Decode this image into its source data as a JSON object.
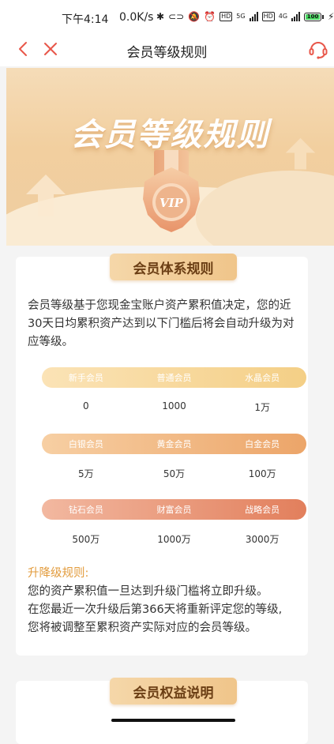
{
  "status_bar": {
    "time": "下午4:14",
    "speed": "0.0K/s",
    "battery": "100",
    "network_1": "5G",
    "network_2": "4G",
    "hd_1": "HD",
    "hd_2": "HD"
  },
  "nav": {
    "title": "会员等级规则",
    "back_icon": "chevron-left-icon",
    "close_icon": "close-icon",
    "service_icon": "headset-icon",
    "accent_color": "#e8574a"
  },
  "banner": {
    "title": "会员等级规则",
    "medal_label": "VIP"
  },
  "section1": {
    "tag": "会员体系规则",
    "intro": "会员等级基于您现金宝账户资产累积值决定，您的近30天日均累积资产达到以下门槛后将会自动升级为对应等级。",
    "levels": [
      {
        "name": "新手会员",
        "threshold": "0"
      },
      {
        "name": "普通会员",
        "threshold": "1000"
      },
      {
        "name": "水晶会员",
        "threshold": "1万"
      },
      {
        "name": "白银会员",
        "threshold": "5万"
      },
      {
        "name": "黄金会员",
        "threshold": "50万"
      },
      {
        "name": "白金会员",
        "threshold": "100万"
      },
      {
        "name": "钻石会员",
        "threshold": "500万"
      },
      {
        "name": "财富会员",
        "threshold": "1000万"
      },
      {
        "name": "战略会员",
        "threshold": "3000万"
      }
    ],
    "rule_title": "升降级规则:",
    "rule_lines": [
      "您的资产累积值一旦达到升级门槛将立即升级。",
      "在您最近一次升级后第366天将重新评定您的等级,",
      "您将被调整至累积资产实际对应的会员等级。"
    ]
  },
  "section2": {
    "tag": "会员权益说明"
  }
}
